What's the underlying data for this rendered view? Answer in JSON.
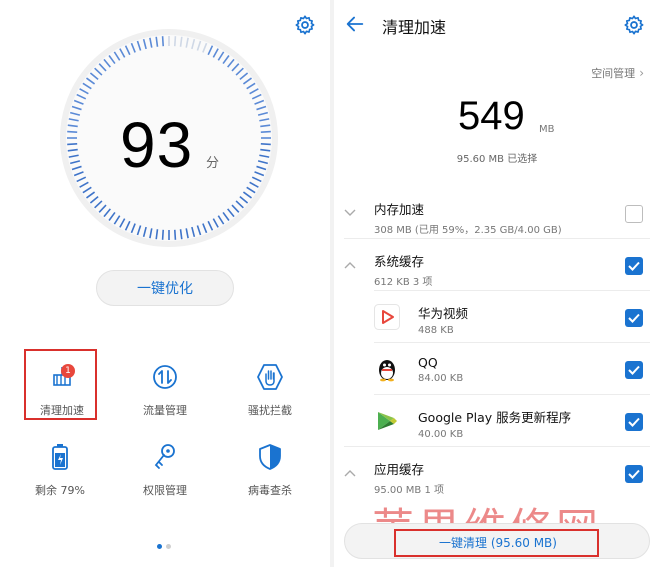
{
  "left": {
    "score": "93",
    "score_unit": "分",
    "optimize_label": "一键优化",
    "cleanup_badge": "1",
    "tools": [
      {
        "label": "清理加速",
        "icon": "broom-icon"
      },
      {
        "label": "流量管理",
        "icon": "data-traffic-icon"
      },
      {
        "label": "骚扰拦截",
        "icon": "hand-block-icon"
      },
      {
        "label": "剩余 79%",
        "icon": "battery-icon"
      },
      {
        "label": "权限管理",
        "icon": "key-icon"
      },
      {
        "label": "病毒查杀",
        "icon": "shield-icon"
      }
    ]
  },
  "right": {
    "title": "清理加速",
    "space_mgmt": "空间管理",
    "total_size": "549",
    "total_unit": "MB",
    "selected_text": "95.60 MB 已选择",
    "sections": [
      {
        "title": "内存加速",
        "sub": "308 MB (已用 59%，2.35 GB/4.00 GB)",
        "checked": false
      },
      {
        "title": "系统缓存",
        "sub": "612 KB  3 项",
        "checked": true
      },
      {
        "title": "华为视频",
        "sub": "488 KB",
        "checked": true
      },
      {
        "title": "QQ",
        "sub": "84.00 KB",
        "checked": true
      },
      {
        "title": "Google Play 服务更新程序",
        "sub": "40.00 KB",
        "checked": true
      },
      {
        "title": "应用缓存",
        "sub": "95.00 MB  1 项",
        "checked": true
      }
    ],
    "clean_button": "一键清理 (95.60 MB)"
  },
  "watermark": "苹果维修网",
  "colors": {
    "accent": "#1a73d0",
    "highlight": "#d9302c",
    "badge": "#e8473c"
  }
}
